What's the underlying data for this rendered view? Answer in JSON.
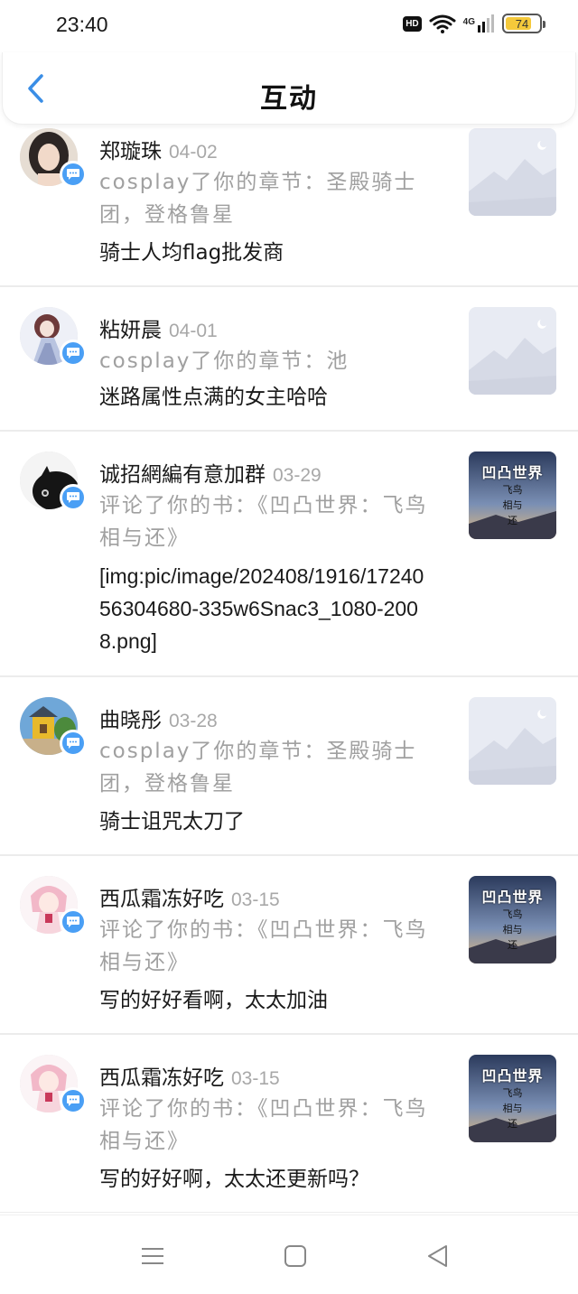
{
  "status_bar": {
    "time": "23:40",
    "hd_label": "HD",
    "network_label": "4G",
    "battery_level": "74"
  },
  "header": {
    "title": "互动",
    "back_icon": "chevron-left-icon"
  },
  "items": [
    {
      "name": "郑璇珠",
      "date": "04-02",
      "action": "cosplay了你的章节：圣殿骑士团，登格鲁星",
      "content": "骑士人均flag批发商",
      "thumb": "placeholder-landscape"
    },
    {
      "name": "粘妍晨",
      "date": "04-01",
      "action": "cosplay了你的章节：池",
      "content": "迷路属性点满的女主哈哈",
      "thumb": "placeholder-landscape"
    },
    {
      "name": "诚招網編有意加群",
      "date": "03-29",
      "action": "评论了你的书：《凹凸世界：飞鸟相与还》",
      "content": "[img:pic/image/202408/1916/1724056304680-335w6Snac3_1080-2008.png]",
      "thumb": "book-cover"
    },
    {
      "name": "曲晓彤",
      "date": "03-28",
      "action": "cosplay了你的章节：圣殿骑士团，登格鲁星",
      "content": "骑士诅咒太刀了",
      "thumb": "placeholder-landscape"
    },
    {
      "name": "西瓜霜冻好吃",
      "date": "03-15",
      "action": "评论了你的书：《凹凸世界：飞鸟相与还》",
      "content": "写的好好看啊，太太加油",
      "thumb": "book-cover"
    },
    {
      "name": "西瓜霜冻好吃",
      "date": "03-15",
      "action": "评论了你的书：《凹凸世界：飞鸟相与还》",
      "content": "写的好好啊，太太还更新吗？",
      "thumb": "book-cover"
    }
  ],
  "book_cover": {
    "title": "凹凸世界",
    "subtitle_lines": [
      "飞鸟",
      "相与",
      "还"
    ]
  },
  "colors": {
    "accent": "#4a9ff5",
    "secondary_text": "#a0a0a0",
    "primary_text": "#1a1a1a"
  },
  "nav_bar": {
    "menu_icon": "menu-icon",
    "home_icon": "square-home-icon",
    "back_icon": "triangle-back-icon"
  }
}
